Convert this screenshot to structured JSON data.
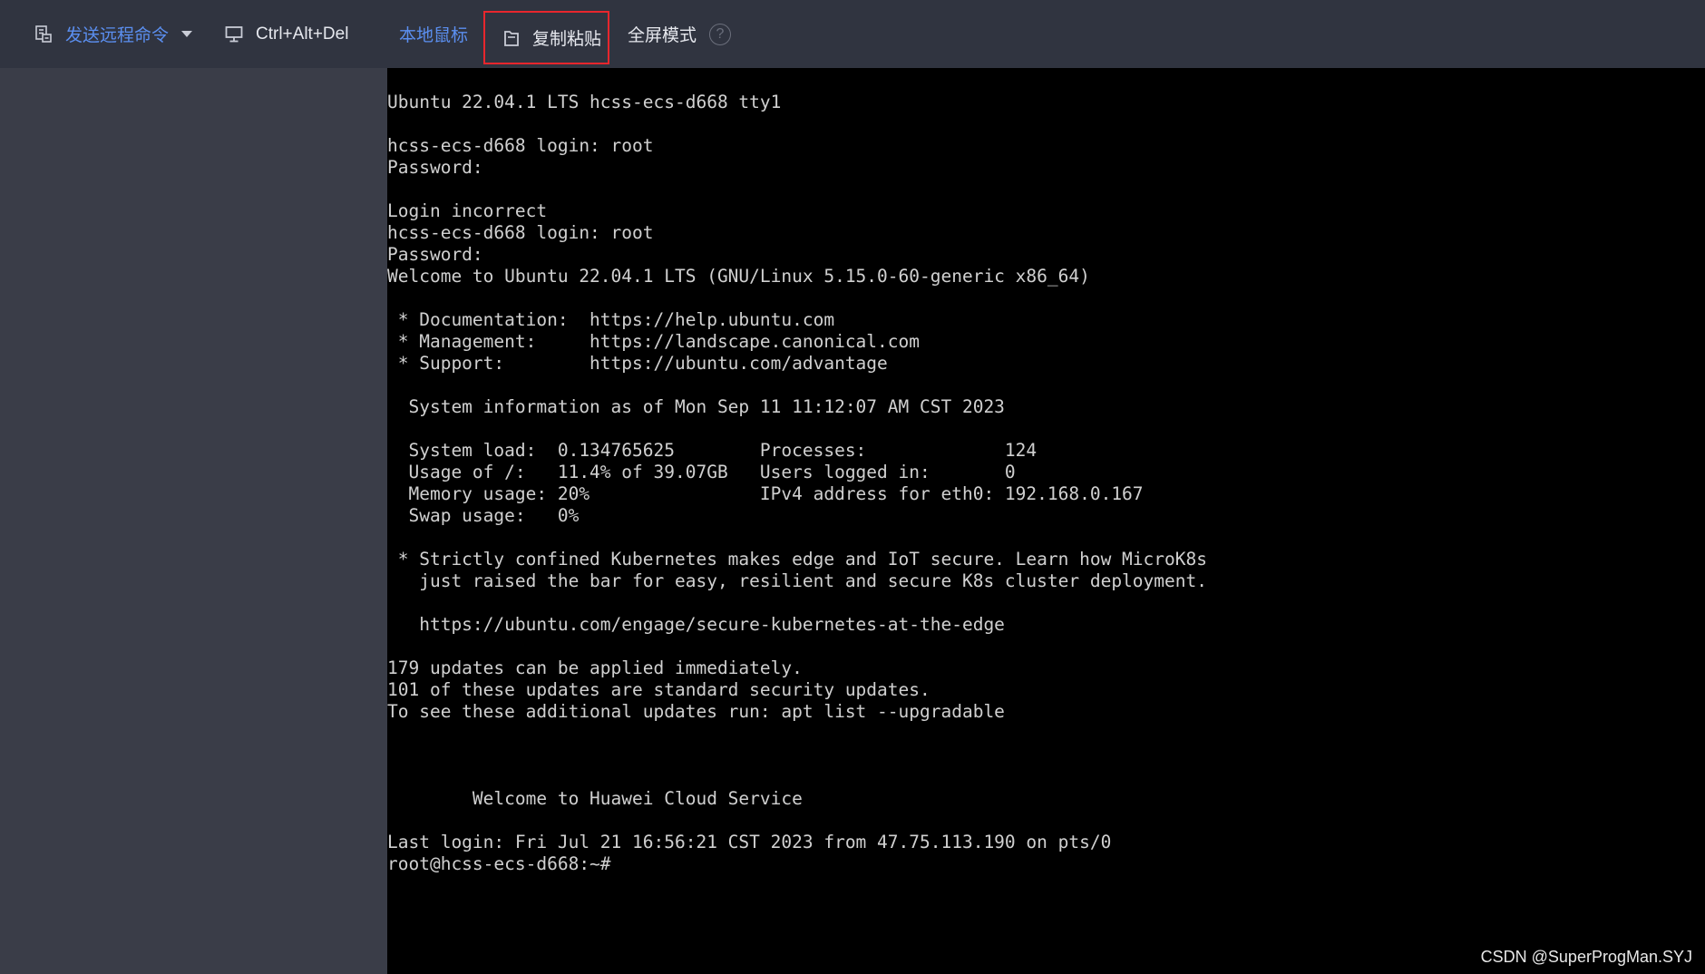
{
  "toolbar": {
    "send_command_label": "发送远程命令",
    "ctrl_alt_del_label": "Ctrl+Alt+Del",
    "local_mouse_label": "本地鼠标",
    "copy_paste_label": "复制粘贴",
    "fullscreen_label": "全屏模式",
    "help_glyph": "?",
    "send_command_icon": "command-list-icon",
    "ctrl_alt_del_icon": "monitor-icon",
    "copy_paste_icon": "clipboard-icon",
    "active_color": "#5b8ff0",
    "highlight_color": "#e8262d"
  },
  "terminal": {
    "lines": [
      "Ubuntu 22.04.1 LTS hcss-ecs-d668 tty1",
      "",
      "hcss-ecs-d668 login: root",
      "Password:",
      "",
      "Login incorrect",
      "hcss-ecs-d668 login: root",
      "Password:",
      "Welcome to Ubuntu 22.04.1 LTS (GNU/Linux 5.15.0-60-generic x86_64)",
      "",
      " * Documentation:  https://help.ubuntu.com",
      " * Management:     https://landscape.canonical.com",
      " * Support:        https://ubuntu.com/advantage",
      "",
      "  System information as of Mon Sep 11 11:12:07 AM CST 2023",
      "",
      "  System load:  0.134765625        Processes:             124",
      "  Usage of /:   11.4% of 39.07GB   Users logged in:       0",
      "  Memory usage: 20%                IPv4 address for eth0: 192.168.0.167",
      "  Swap usage:   0%",
      "",
      " * Strictly confined Kubernetes makes edge and IoT secure. Learn how MicroK8s",
      "   just raised the bar for easy, resilient and secure K8s cluster deployment.",
      "",
      "   https://ubuntu.com/engage/secure-kubernetes-at-the-edge",
      "",
      "179 updates can be applied immediately.",
      "101 of these updates are standard security updates.",
      "To see these additional updates run: apt list --upgradable",
      "",
      "",
      "",
      "        Welcome to Huawei Cloud Service",
      "",
      "Last login: Fri Jul 21 16:56:21 CST 2023 from 47.75.113.190 on pts/0",
      "root@hcss-ecs-d668:~#"
    ]
  },
  "watermark": "CSDN @SuperProgMan.SYJ"
}
